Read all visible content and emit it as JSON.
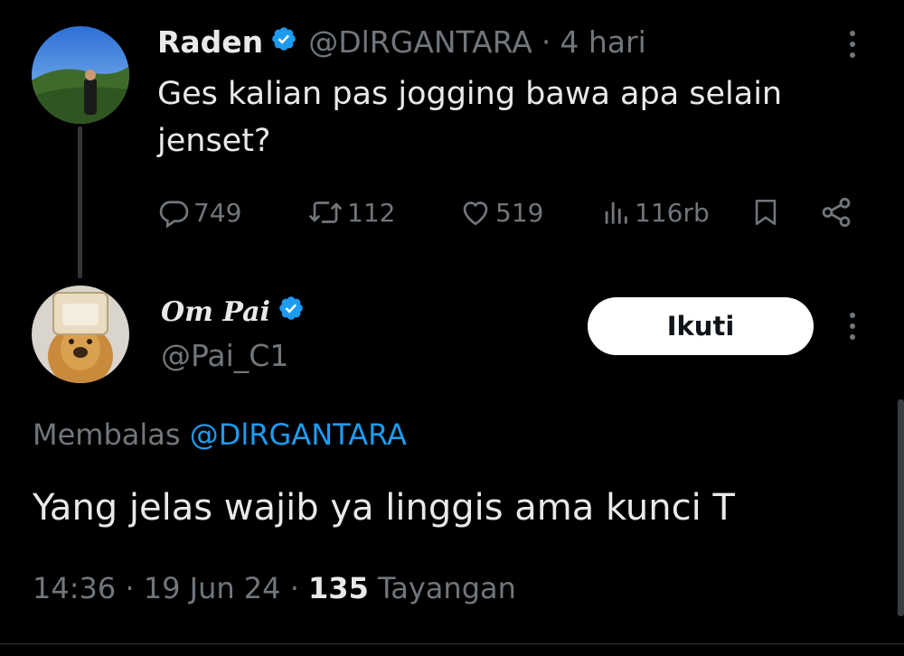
{
  "original_tweet": {
    "display_name": "Raden",
    "handle": "@DlRGANTARA",
    "separator": "·",
    "time_ago": "4 hari",
    "text": "Ges kalian pas jogging bawa apa selain jenset?",
    "verified_icon": "verified-badge-icon",
    "actions": {
      "replies": "749",
      "retweets": "112",
      "likes": "519",
      "views": "116rb"
    }
  },
  "reply_tweet": {
    "display_name": "Om Pai",
    "handle": "@Pai_C1",
    "follow_label": "Ikuti",
    "replying_prefix": "Membalas",
    "replying_to": "@DlRGANTARA",
    "text": "Yang jelas wajib ya linggis ama kunci T",
    "time": "14:36",
    "date": "19 Jun 24",
    "separator": "·",
    "views_count": "135",
    "views_label": "Tayangan"
  },
  "colors": {
    "background": "#000000",
    "text": "#e7e9ea",
    "muted": "#71767b",
    "accent": "#1d9bf0",
    "button_bg": "#ffffff"
  }
}
